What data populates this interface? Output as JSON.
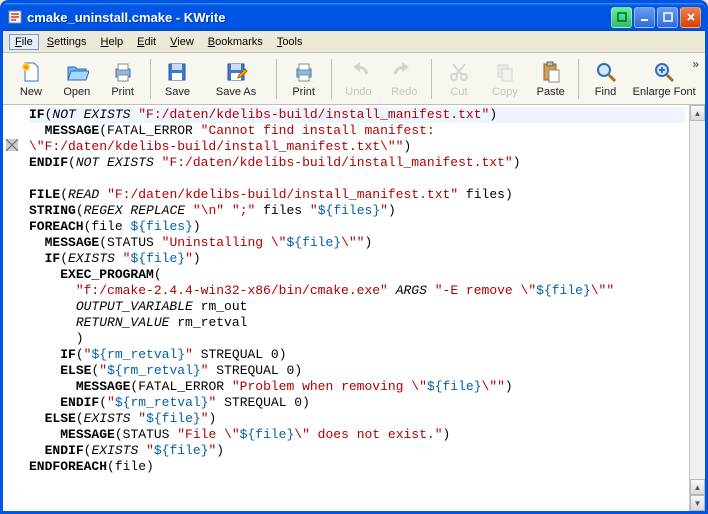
{
  "window": {
    "title": "cmake_uninstall.cmake - KWrite"
  },
  "menu": {
    "file": "File",
    "settings": "Settings",
    "help": "Help",
    "edit": "Edit",
    "view": "View",
    "bookmarks": "Bookmarks",
    "tools": "Tools"
  },
  "toolbar": {
    "new": "New",
    "open": "Open",
    "print": "Print",
    "save": "Save",
    "saveas": "Save As",
    "print2": "Print",
    "undo": "Undo",
    "redo": "Redo",
    "cut": "Cut",
    "copy": "Copy",
    "paste": "Paste",
    "find": "Find",
    "enlarge": "Enlarge Font"
  },
  "code": {
    "l1a": "IF",
    "l1b": "NOT EXISTS",
    "l1c": "\"F:/daten/kdelibs-build/install_manifest.txt\"",
    "l2a": "MESSAGE",
    "l2b": "FATAL_ERROR ",
    "l2c": "\"Cannot find install manifest:",
    "l3a": "\\\"F:/daten/kdelibs-build/install_manifest.txt\\\"\"",
    "l4a": "ENDIF",
    "l4b": "NOT EXISTS",
    "l4c": "\"F:/daten/kdelibs-build/install_manifest.txt\"",
    "l6a": "FILE",
    "l6b": "READ",
    "l6c": "\"F:/daten/kdelibs-build/install_manifest.txt\"",
    "l6d": " files",
    "l7a": "STRING",
    "l7b": "REGEX REPLACE",
    "l7c": "\"\\n\"",
    "l7d": "\";\"",
    "l7e": " files ",
    "l7f": "\"",
    "l7g": "${files}",
    "l7h": "\"",
    "l8a": "FOREACH",
    "l8b": "file ",
    "l8c": "${files}",
    "l9a": "MESSAGE",
    "l9b": "STATUS ",
    "l9c": "\"Uninstalling \\\"",
    "l9d": "${file}",
    "l9e": "\\\"\"",
    "l10a": "IF",
    "l10b": "EXISTS",
    "l10c": "\"",
    "l10d": "${file}",
    "l10e": "\"",
    "l11a": "EXEC_PROGRAM",
    "l12a": "\"f:/cmake-2.4.4-win32-x86/bin/cmake.exe\"",
    "l12b": "ARGS",
    "l12c": "\"-E remove \\\"",
    "l12d": "${file}",
    "l12e": "\\\"\"",
    "l13a": "OUTPUT_VARIABLE",
    "l13b": " rm_out",
    "l14a": "RETURN_VALUE",
    "l14b": " rm_retval",
    "l16a": "IF",
    "l16b": "\"",
    "l16c": "${rm_retval}",
    "l16d": "\"",
    "l16e": " STREQUAL 0",
    "l17a": "ELSE",
    "l17b": "\"",
    "l17c": "${rm_retval}",
    "l17d": "\"",
    "l17e": " STREQUAL 0",
    "l18a": "MESSAGE",
    "l18b": "FATAL_ERROR ",
    "l18c": "\"Problem when removing \\\"",
    "l18d": "${file}",
    "l18e": "\\\"\"",
    "l19a": "ENDIF",
    "l19b": "\"",
    "l19c": "${rm_retval}",
    "l19d": "\"",
    "l19e": " STREQUAL 0",
    "l20a": "ELSE",
    "l20b": "EXISTS",
    "l20c": "\"",
    "l20d": "${file}",
    "l20e": "\"",
    "l21a": "MESSAGE",
    "l21b": "STATUS ",
    "l21c": "\"File \\\"",
    "l21d": "${file}",
    "l21e": "\\\" does not exist.\"",
    "l22a": "ENDIF",
    "l22b": "EXISTS",
    "l22c": "\"",
    "l22d": "${file}",
    "l22e": "\"",
    "l23a": "ENDFOREACH",
    "l23b": "file"
  }
}
